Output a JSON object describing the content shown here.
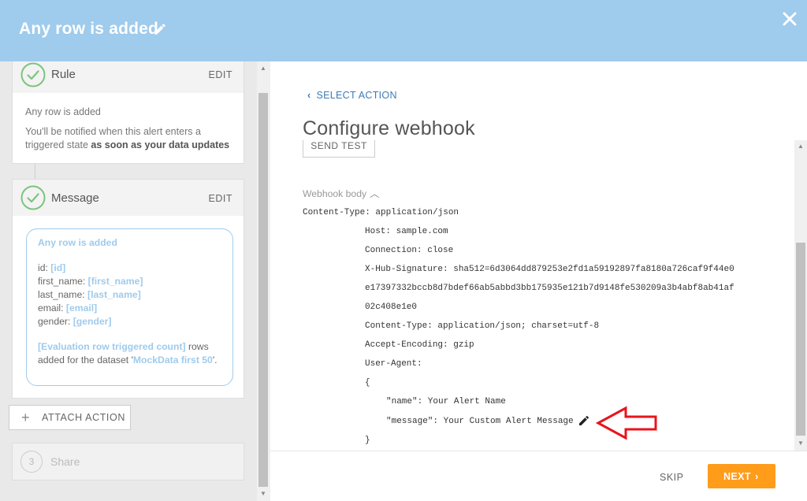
{
  "header": {
    "title": "Any row is added",
    "edit_icon": "pencil-icon",
    "close_icon": "close-icon",
    "bg_color": "#9fcbec"
  },
  "steps": {
    "rule": {
      "title": "Rule",
      "edit_label": "EDIT",
      "summary": "Any row is added",
      "description_prefix": "You'll be notified when this alert enters a triggered state ",
      "description_bold": "as soon as your data updates"
    },
    "message": {
      "title": "Message",
      "edit_label": "EDIT",
      "bubble": {
        "title": "Any row is added",
        "fields": [
          {
            "label": "id: ",
            "value": "[id]"
          },
          {
            "label": "first_name: ",
            "value": "[first_name]"
          },
          {
            "label": "last_name: ",
            "value": "[last_name]"
          },
          {
            "label": "email: ",
            "value": "[email]"
          },
          {
            "label": "gender: ",
            "value": "[gender]"
          }
        ],
        "footer_highlight": "[Evaluation row triggered count]",
        "footer_text_1": " rows added for the dataset '",
        "footer_dataset": "MockData first 50",
        "footer_text_2": "'."
      }
    },
    "attach_action": {
      "label": "ATTACH ACTION",
      "icon": "plus-icon"
    },
    "share": {
      "number": "3",
      "title": "Share"
    }
  },
  "main": {
    "back_label": "SELECT ACTION",
    "title": "Configure webhook",
    "send_test_label": "SEND TEST",
    "webhook_body_label": "Webhook body",
    "webhook_lines": [
      "Content-Type: application/json",
      "Host: sample.com",
      "Connection: close",
      "X-Hub-Signature: sha512=6d3064dd879253e2fd1a59192897fa8180a726caf9f44e0",
      "e17397332bccb8d7bdef66ab5abbd3bb175935e121b7d9148fe530209a3b4abf8ab41af",
      "02c408e1e0",
      "Content-Type: application/json; charset=utf-8",
      "Accept-Encoding: gzip",
      "User-Agent:",
      "{",
      "\"name\": Your Alert Name",
      "\"message\": Your Custom Alert Message",
      "}"
    ],
    "skip_label": "SKIP",
    "next_label": "NEXT"
  },
  "colors": {
    "accent_blue": "#9fcbec",
    "link_blue": "#3d7cb5",
    "success_green": "#7cc47f",
    "next_orange": "#ff9c1a",
    "annotation_red": "#e8141b"
  }
}
